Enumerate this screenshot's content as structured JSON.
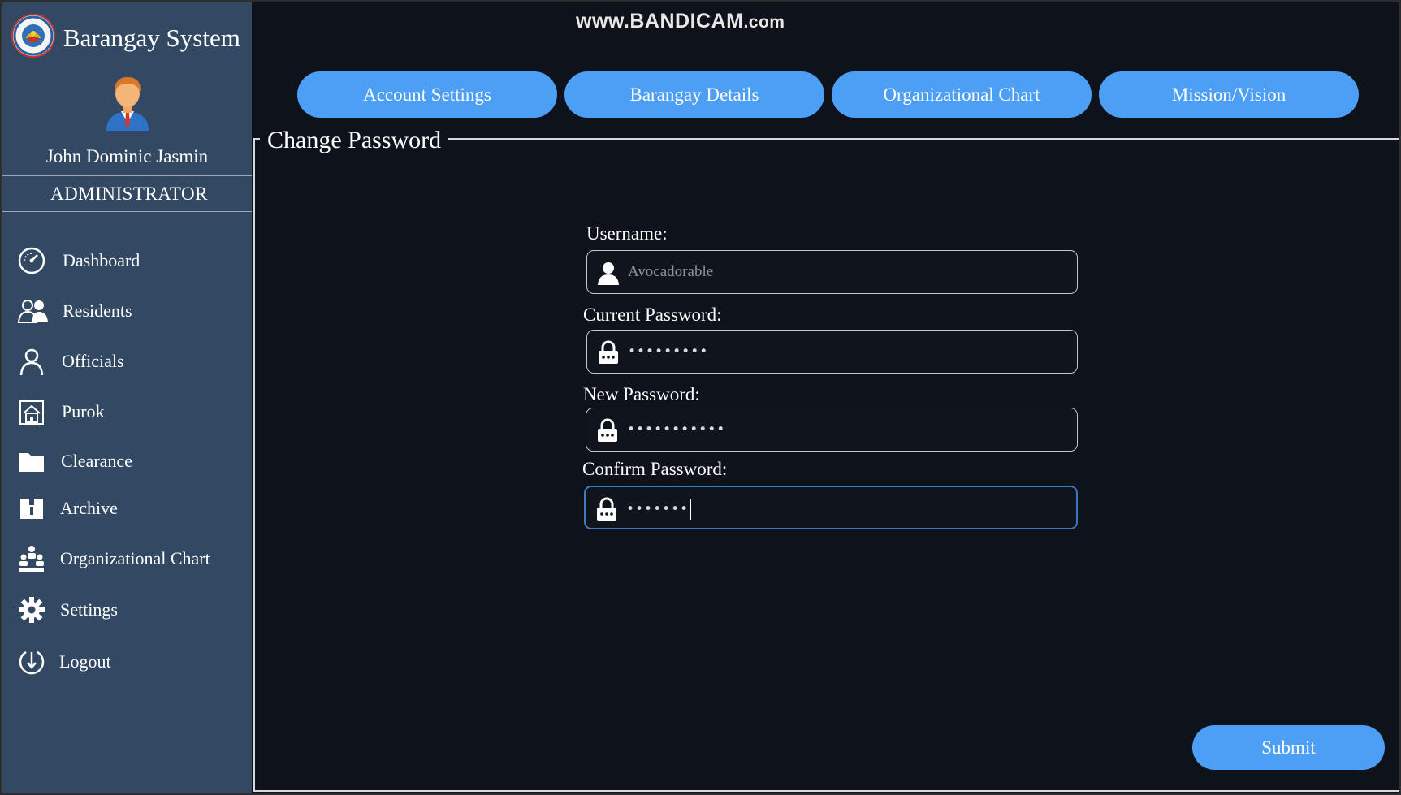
{
  "app": {
    "title": "Barangay System",
    "watermark": {
      "main": "www.BANDICAM",
      "suffix": ".com"
    }
  },
  "user": {
    "name": "John Dominic Jasmin",
    "role": "ADMINISTRATOR"
  },
  "sidebar": {
    "items": [
      {
        "label": "Dashboard",
        "icon": "dashboard-gauge-icon"
      },
      {
        "label": "Residents",
        "icon": "residents-icon"
      },
      {
        "label": "Officials",
        "icon": "official-person-icon"
      },
      {
        "label": "Purok",
        "icon": "purok-house-icon"
      },
      {
        "label": "Clearance",
        "icon": "folder-icon"
      },
      {
        "label": "Archive",
        "icon": "archive-icon"
      },
      {
        "label": "Organizational Chart",
        "icon": "org-chart-icon"
      },
      {
        "label": "Settings",
        "icon": "gear-icon"
      },
      {
        "label": "Logout",
        "icon": "logout-icon"
      }
    ]
  },
  "tabs": [
    {
      "label": "Account Settings"
    },
    {
      "label": "Barangay Details"
    },
    {
      "label": "Organizational Chart"
    },
    {
      "label": "Mission/Vision"
    }
  ],
  "form": {
    "title": "Change Password",
    "username": {
      "label": "Username:",
      "placeholder": "Avocadorable"
    },
    "current_password": {
      "label": "Current Password:",
      "value": "•••••••••"
    },
    "new_password": {
      "label": "New Password:",
      "value": "•••••••••••"
    },
    "confirm_password": {
      "label": "Confirm Password:",
      "value": "•••••••"
    },
    "submit_label": "Submit"
  },
  "colors": {
    "sidebar_bg": "#334963",
    "main_bg": "#0d121b",
    "accent": "#4d9ff5",
    "active_border": "#3f78bd"
  }
}
